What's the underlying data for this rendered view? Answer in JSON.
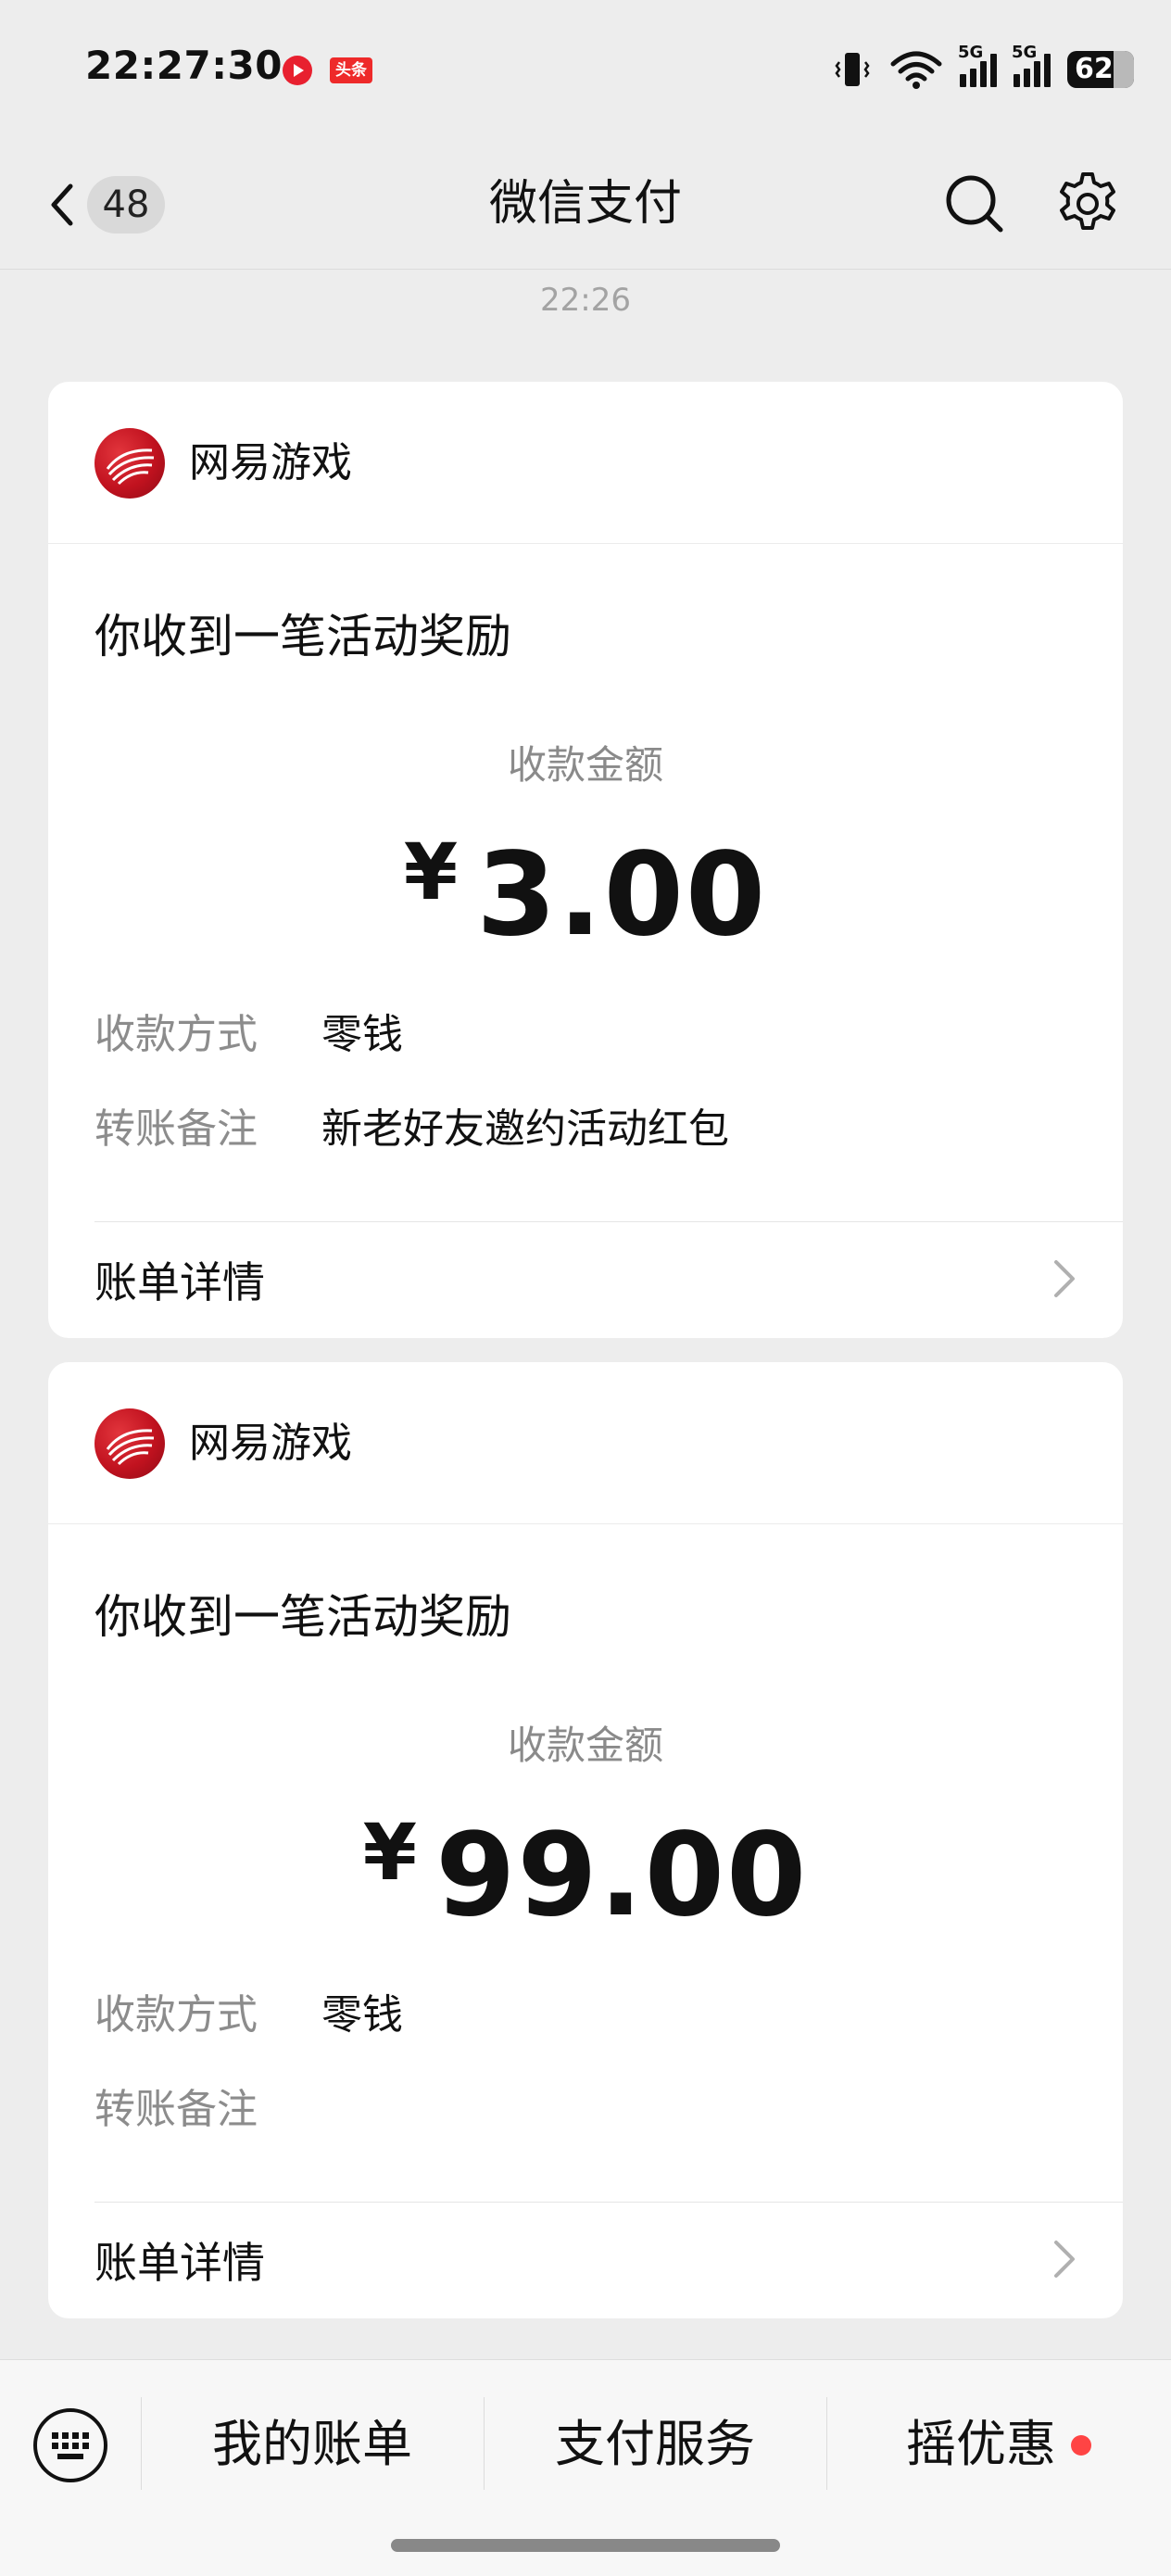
{
  "status_bar": {
    "time": "22:27:30",
    "news_badge": "头条",
    "signal_1_label": "5G",
    "signal_2_label": "5G",
    "battery_level": "62"
  },
  "nav": {
    "back_count": "48",
    "title": "微信支付"
  },
  "chat_time": "22:26",
  "cards": [
    {
      "merchant": "网易游戏",
      "title": "你收到一笔活动奖励",
      "amount_label": "收款金额",
      "currency": "¥",
      "amount": "3.00",
      "method_key": "收款方式",
      "method_value": "零钱",
      "note_key": "转账备注",
      "note_value": "新老好友邀约活动红包",
      "detail_link": "账单详情"
    },
    {
      "merchant": "网易游戏",
      "title": "你收到一笔活动奖励",
      "amount_label": "收款金额",
      "currency": "¥",
      "amount": "99.00",
      "method_key": "收款方式",
      "method_value": "零钱",
      "note_key": "转账备注",
      "note_value": "",
      "detail_link": "账单详情"
    }
  ],
  "bottom_menu": {
    "item_1": "我的账单",
    "item_2": "支付服务",
    "item_3": "摇优惠"
  },
  "colors": {
    "background": "#ededed",
    "card": "#ffffff",
    "secondary_text": "#8c8c8c",
    "promo_dot": "#ff4444"
  }
}
